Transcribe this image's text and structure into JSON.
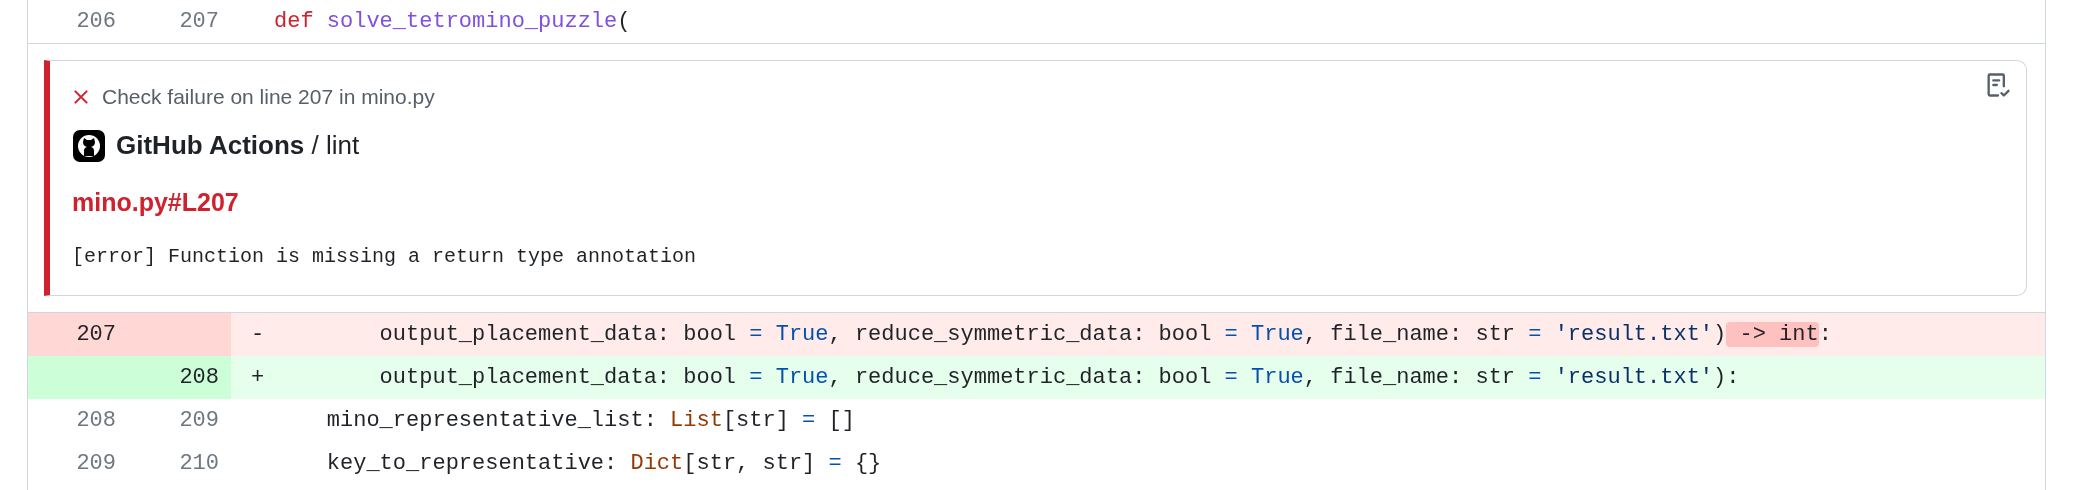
{
  "lines_before": [
    {
      "kind": "context",
      "old": "206",
      "new": "207",
      "tokens": [
        {
          "text": "def ",
          "kind": "keyword"
        },
        {
          "text": "solve_tetromino_puzzle",
          "kind": "function"
        },
        {
          "text": "(",
          "kind": "plain"
        }
      ]
    }
  ],
  "annotation": {
    "title": "Check failure on line 207 in mino.py",
    "app": "GitHub Actions",
    "job": " / lint",
    "link": "mino.py#L207",
    "message": "[error] Function is missing a return type annotation"
  },
  "lines_after": [
    {
      "kind": "removed",
      "old": "207",
      "marker": "-",
      "tokens": [
        {
          "text": "        output_placement_data: bool ",
          "kind": "plain"
        },
        {
          "text": "= ",
          "kind": "operator"
        },
        {
          "text": "True",
          "kind": "constant"
        },
        {
          "text": ", reduce_symmetric_data: bool ",
          "kind": "plain"
        },
        {
          "text": "= ",
          "kind": "operator"
        },
        {
          "text": "True",
          "kind": "constant"
        },
        {
          "text": ", file_name: str ",
          "kind": "plain"
        },
        {
          "text": "= ",
          "kind": "operator"
        },
        {
          "text": "'result.txt'",
          "kind": "string"
        },
        {
          "text": ")",
          "kind": "plain"
        },
        {
          "text": " -> int",
          "kind": "deleted_word"
        },
        {
          "text": ":",
          "kind": "plain"
        }
      ]
    },
    {
      "kind": "added",
      "new": "208",
      "marker": "+",
      "tokens": [
        {
          "text": "        output_placement_data: bool ",
          "kind": "plain"
        },
        {
          "text": "= ",
          "kind": "operator"
        },
        {
          "text": "True",
          "kind": "constant"
        },
        {
          "text": ", reduce_symmetric_data: bool ",
          "kind": "plain"
        },
        {
          "text": "= ",
          "kind": "operator"
        },
        {
          "text": "True",
          "kind": "constant"
        },
        {
          "text": ", file_name: str ",
          "kind": "plain"
        },
        {
          "text": "= ",
          "kind": "operator"
        },
        {
          "text": "'result.txt'",
          "kind": "string"
        },
        {
          "text": "):",
          "kind": "plain"
        }
      ]
    },
    {
      "kind": "context",
      "old": "208",
      "new": "209",
      "tokens": [
        {
          "text": "    mino_representative_list: ",
          "kind": "plain"
        },
        {
          "text": "List",
          "kind": "type"
        },
        {
          "text": "[str] ",
          "kind": "plain"
        },
        {
          "text": "=",
          "kind": "operator"
        },
        {
          "text": " []",
          "kind": "plain"
        }
      ]
    },
    {
      "kind": "context",
      "old": "209",
      "new": "210",
      "tokens": [
        {
          "text": "    key_to_representative: ",
          "kind": "plain"
        },
        {
          "text": "Dict",
          "kind": "type"
        },
        {
          "text": "[str, str] ",
          "kind": "plain"
        },
        {
          "text": "=",
          "kind": "operator"
        },
        {
          "text": " {}",
          "kind": "plain"
        }
      ]
    }
  ]
}
